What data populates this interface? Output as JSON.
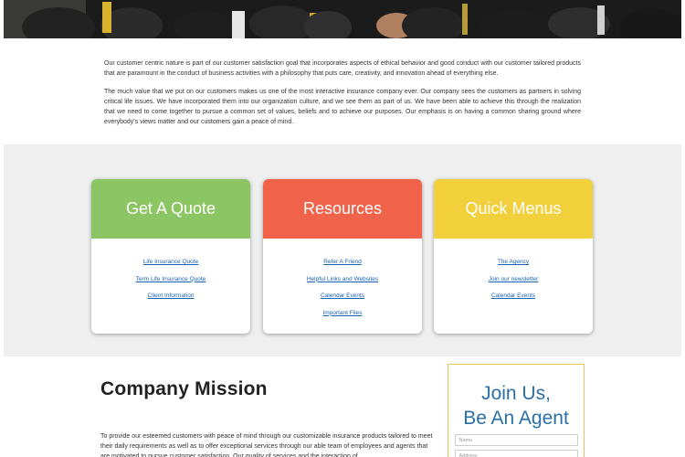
{
  "intro": {
    "paragraphs": [
      "Our customer centric nature is part of our customer satisfaction goal that incorporates aspects of ethical behavior and good conduct with our customer tailored products that are paramount in the conduct of business activities with a philosophy that puts care, creativity, and innovation ahead of everything else.",
      "The much value that we put on our customers makes us one of the most interactive insurance company ever. Our company sees the customers as partners in solving critical life issues. We have incorporated them into our organization culture, and we see them as part of us. We have been able to achieve this through the realization that we need to come together to pursue a common set of values, beliefs and to achieve our purposes. Our emphasis is on having a common sharing ground where everybody's views matter and our customers gain a peace of mind."
    ]
  },
  "cards": [
    {
      "title": "Get A Quote",
      "color": "#8cc563",
      "links": [
        "Life Insurance Quote",
        "Term Life Insurance Quote",
        "Client Information"
      ]
    },
    {
      "title": "Resources",
      "color": "#f0624a",
      "links": [
        "Refer A Friend",
        "Helpful Links and Websites",
        "Calendar Events",
        "Important Files"
      ]
    },
    {
      "title": "Quick Menus",
      "color": "#f2d03b",
      "links": [
        "The Agency",
        "Join our newsletter",
        "Calendar Events"
      ]
    }
  ],
  "mission": {
    "title": "Company Mission",
    "text": "To provide our esteemed customers with peace of mind through our customizable insurance products tailored to meet their daily requirements as well as to offer exceptional services through our able team of employees and agents that are motivated to pursue customer satisfaction. Our quality of services and the interaction of"
  },
  "join": {
    "title_line1": "Join Us,",
    "title_line2": "Be An Agent",
    "name_placeholder": "Name",
    "address_placeholder": "Address"
  }
}
